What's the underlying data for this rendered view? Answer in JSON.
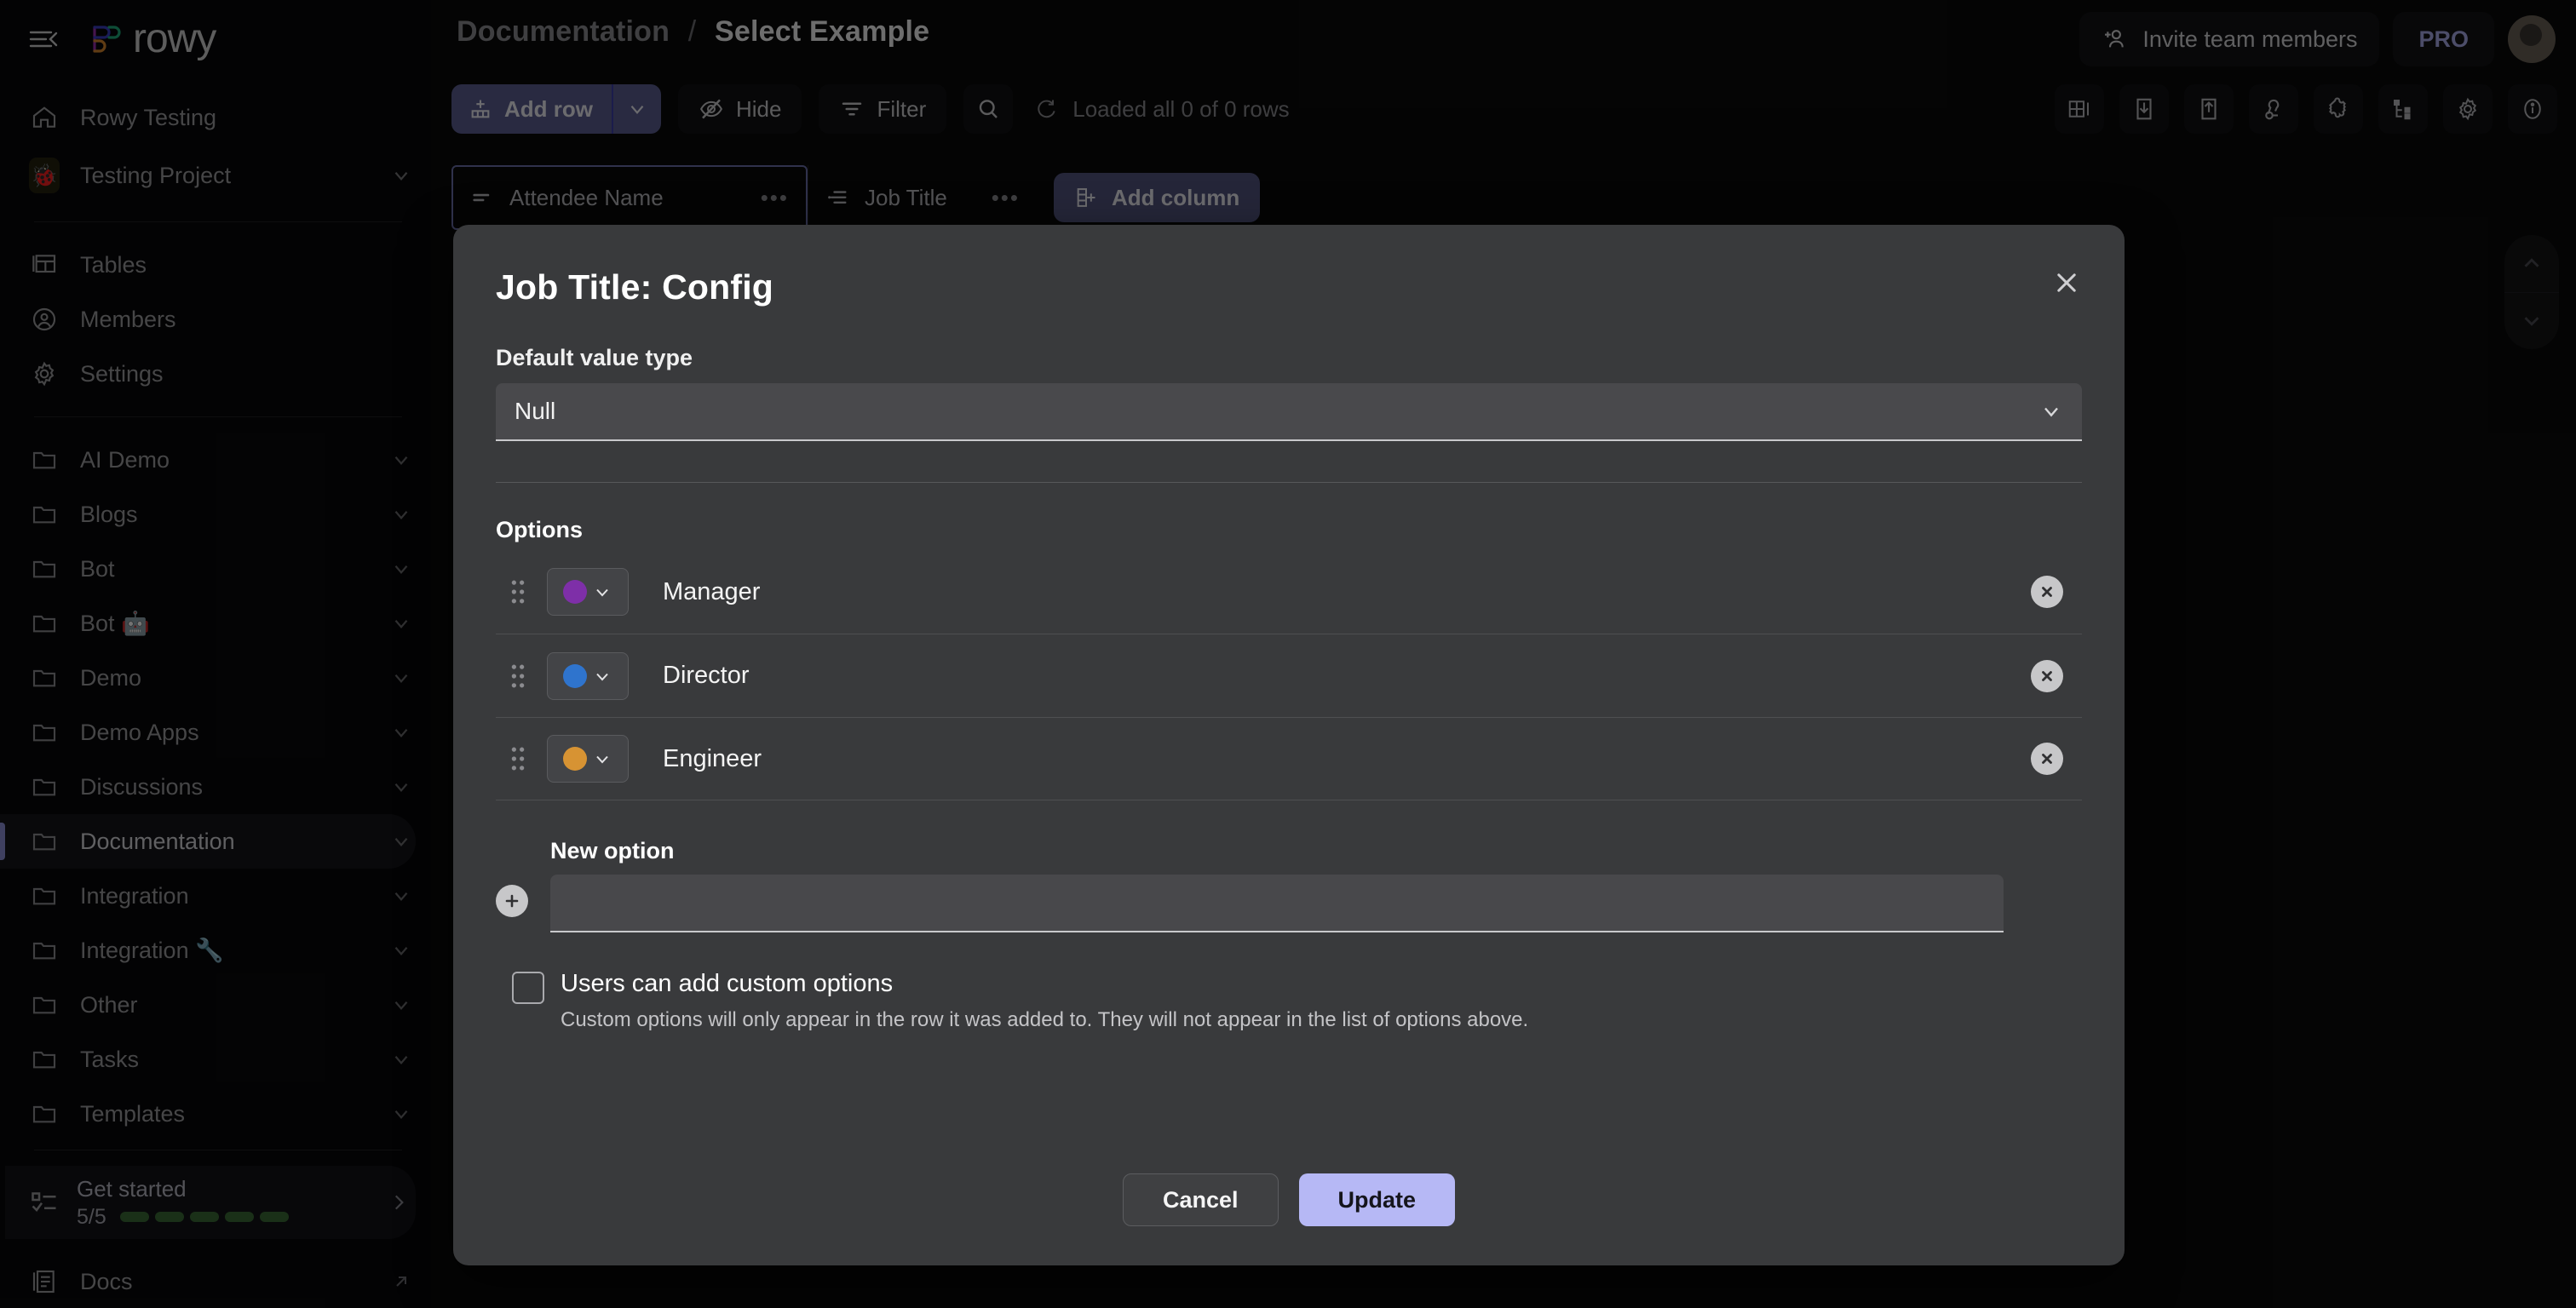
{
  "app": {
    "logo_text": "rowy",
    "collapse_icon": "collapse-sidebar-icon"
  },
  "sidebar": {
    "home": {
      "label": "Rowy Testing",
      "icon": "home-icon"
    },
    "project": {
      "label": "Testing Project",
      "icon": "ladybug-emoji",
      "emoji": "🐞",
      "chevron": "chevron-down-icon"
    },
    "primary_items": [
      {
        "label": "Tables",
        "icon": "table-icon"
      },
      {
        "label": "Members",
        "icon": "person-circle-icon"
      },
      {
        "label": "Settings",
        "icon": "gear-icon"
      }
    ],
    "folders": [
      {
        "label": "AI Demo",
        "active": false
      },
      {
        "label": "Blogs",
        "active": false
      },
      {
        "label": "Bot",
        "active": false
      },
      {
        "label": "Bot 🤖",
        "active": false
      },
      {
        "label": "Demo",
        "active": false
      },
      {
        "label": "Demo Apps",
        "active": false
      },
      {
        "label": "Discussions",
        "active": false
      },
      {
        "label": "Documentation",
        "active": true
      },
      {
        "label": "Integration",
        "active": false
      },
      {
        "label": "Integration 🔧",
        "active": false
      },
      {
        "label": "Other",
        "active": false
      },
      {
        "label": "Tasks",
        "active": false
      },
      {
        "label": "Templates",
        "active": false
      }
    ],
    "get_started": {
      "title": "Get started",
      "count": "5/5",
      "steps_complete": 5,
      "icon": "checklist-icon",
      "arrow": "chevron-right-icon"
    },
    "docs": {
      "label": "Docs",
      "icon": "docs-icon",
      "external": "external-link-icon"
    }
  },
  "topbar": {
    "breadcrumb_parent": "Documentation",
    "breadcrumb_separator": "/",
    "breadcrumb_current": "Select Example",
    "invite_label": "Invite team members",
    "invite_icon": "person-add-icon",
    "pro_label": "PRO",
    "avatar": "user-avatar"
  },
  "toolbar": {
    "add_row_label": "Add row",
    "add_row_icon": "add-row-icon",
    "add_row_caret": "chevron-down-icon",
    "hide_label": "Hide",
    "hide_icon": "eye-off-icon",
    "filter_label": "Filter",
    "filter_icon": "filter-icon",
    "search_icon": "search-icon",
    "loaded_label": "Loaded all 0 of 0 rows",
    "loaded_icon": "refresh-icon",
    "right_icons": [
      "row-height-icon",
      "import-icon",
      "export-icon",
      "webhook-icon",
      "extensions-icon",
      "cloud-logs-icon",
      "table-settings-icon",
      "info-icon"
    ]
  },
  "columns": {
    "items": [
      {
        "label": "Attendee Name",
        "icon": "short-text-icon",
        "menu": "•••",
        "selected": true
      },
      {
        "label": "Job Title",
        "icon": "single-select-icon",
        "menu": "•••",
        "selected": false
      }
    ],
    "add_column_label": "Add column",
    "add_column_icon": "add-column-icon"
  },
  "scroll_control": {
    "up": "chevron-up-icon",
    "down": "chevron-down-icon"
  },
  "modal": {
    "title": "Job Title: Config",
    "close_icon": "close-icon",
    "default_value_type_label": "Default value type",
    "default_value_type_value": "Null",
    "default_value_type_caret": "chevron-down-icon",
    "options_label": "Options",
    "options": [
      {
        "name": "Manager",
        "color": "#7e2fa8",
        "drag": "drag-handle-icon",
        "caret": "chevron-down-icon",
        "delete": "delete-circle-icon"
      },
      {
        "name": "Director",
        "color": "#2f74cd",
        "drag": "drag-handle-icon",
        "caret": "chevron-down-icon",
        "delete": "delete-circle-icon"
      },
      {
        "name": "Engineer",
        "color": "#d79333",
        "drag": "drag-handle-icon",
        "caret": "chevron-down-icon",
        "delete": "delete-circle-icon"
      }
    ],
    "new_option_label": "New option",
    "new_option_value": "",
    "new_option_placeholder": "",
    "new_option_add_icon": "add-circle-icon",
    "custom_options_checkbox_label": "Users can add custom options",
    "custom_options_checked": false,
    "custom_options_help": "Custom options will only appear in the row it was added to. They will not appear in the list of options above.",
    "cancel_label": "Cancel",
    "update_label": "Update"
  },
  "colors": {
    "accent": "#b6b8f5",
    "sidebar_bg": "#08080a",
    "modal_bg": "#393a3c",
    "add_row_bg": "#5b5d91"
  }
}
